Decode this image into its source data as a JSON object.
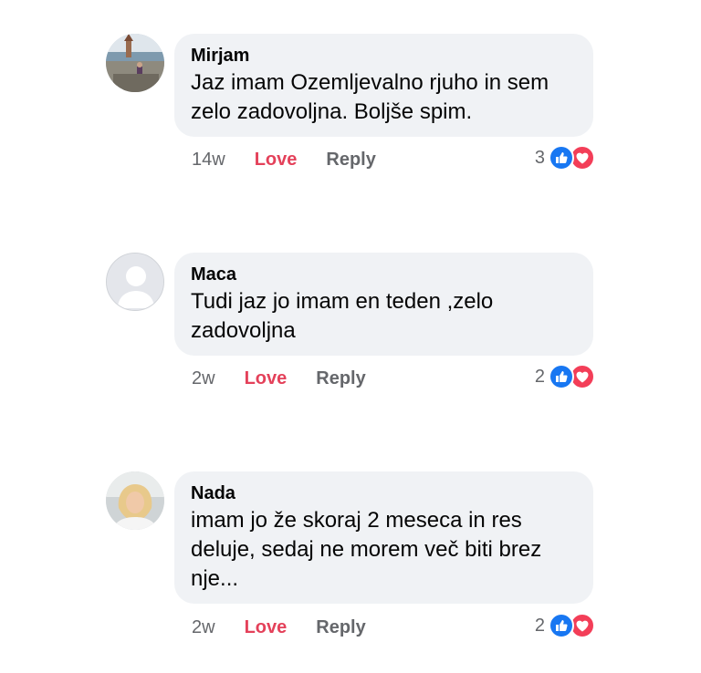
{
  "comments": [
    {
      "author": "Mirjam",
      "text_lines": [
        "Jaz imam Ozemljevalno rjuho in sem",
        "zelo zadovoljna. Boljše spim."
      ],
      "time": "14w",
      "love_label": "Love",
      "reply_label": "Reply",
      "reaction_count": "3",
      "avatar": "photo-avatar-seaside"
    },
    {
      "author": "Maca",
      "text_lines": [
        "Tudi jaz jo imam en teden ,zelo",
        "zadovoljna"
      ],
      "time": "2w",
      "love_label": "Love",
      "reply_label": "Reply",
      "reaction_count": "2",
      "avatar": "default-avatar"
    },
    {
      "author": "Nada",
      "text_lines": [
        "imam jo že skoraj 2 meseca in res",
        "deluje, sedaj ne morem več biti brez",
        "nje..."
      ],
      "time": "2w",
      "love_label": "Love",
      "reply_label": "Reply",
      "reaction_count": "2",
      "avatar": "photo-avatar-blonde-woman"
    }
  ],
  "colors": {
    "bubble": "#f0f2f5",
    "love": "#e4415a",
    "like_reaction": "#1877f2",
    "love_reaction": "#f33e58",
    "muted": "#65676b"
  },
  "icons": [
    "like-reaction-icon",
    "love-reaction-icon"
  ]
}
